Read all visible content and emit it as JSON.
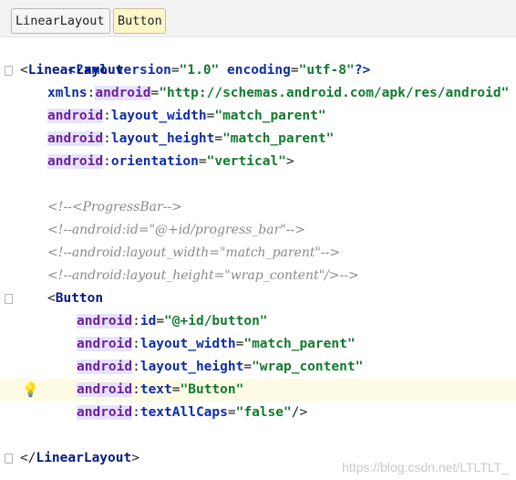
{
  "breadcrumb": {
    "items": [
      "LinearLayout",
      "Button"
    ]
  },
  "lines": {
    "l1": {
      "pi_open": "<?",
      "pi_name": "xml",
      "a1": "version",
      "v1": "\"1.0\"",
      "a2": "encoding",
      "v2": "\"utf-8\"",
      "pi_close": "?>"
    },
    "l2": {
      "open": "<",
      "tag": "LinearLayout"
    },
    "l3": {
      "xmlns": "xmlns",
      "colon": ":",
      "ns": "android",
      "eq": "=",
      "value": "\"http://schemas.android.com/apk/res/android\""
    },
    "l4": {
      "ns": "android",
      "colon": ":",
      "attr": "layout_width",
      "eq": "=",
      "value": "\"match_parent\""
    },
    "l5": {
      "ns": "android",
      "colon": ":",
      "attr": "layout_height",
      "eq": "=",
      "value": "\"match_parent\""
    },
    "l6": {
      "ns": "android",
      "colon": ":",
      "attr": "orientation",
      "eq": "=",
      "value": "\"vertical\"",
      "close": ">"
    },
    "c1": {
      "text": "<!--<ProgressBar-->"
    },
    "c2": {
      "text": "<!--android:id=\"@+id/progress_bar\"-->"
    },
    "c3": {
      "text": "<!--android:layout_width=\"match_parent\"-->"
    },
    "c4": {
      "text": "<!--android:layout_height=\"wrap_content\"/>-->"
    },
    "b0": {
      "open": "<",
      "tag": "Button"
    },
    "b1": {
      "ns": "android",
      "colon": ":",
      "attr": "id",
      "eq": "=",
      "value": "\"@+id/button\""
    },
    "b2": {
      "ns": "android",
      "colon": ":",
      "attr": "layout_width",
      "eq": "=",
      "value": "\"match_parent\""
    },
    "b3": {
      "ns": "android",
      "colon": ":",
      "attr": "layout_height",
      "eq": "=",
      "value": "\"wrap_content\""
    },
    "b4": {
      "ns": "android",
      "colon": ":",
      "attr": "text",
      "eq": "=",
      "value": "\"Button\""
    },
    "b5": {
      "ns": "android",
      "colon": ":",
      "attr": "textAllCaps",
      "eq": "=",
      "value": "\"false\"",
      "close": "/>"
    },
    "end": {
      "open": "</",
      "tag": "LinearLayout",
      "close": ">"
    }
  },
  "gutter": {
    "intention_icon": "lightbulb-icon"
  },
  "watermark": "https://blog.csdn.net/LTLTLT_"
}
